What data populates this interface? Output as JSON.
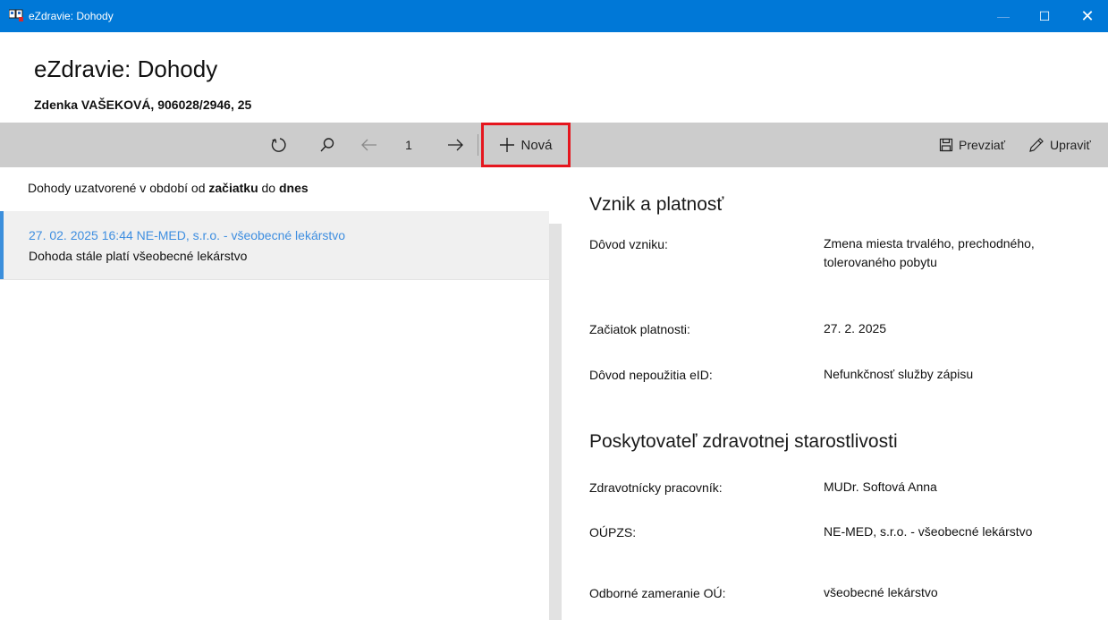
{
  "window": {
    "title": "eZdravie: Dohody",
    "minimize": "—",
    "maximize": "☐",
    "close": "✕"
  },
  "header": {
    "title": "eZdravie: Dohody",
    "patient": "Zdenka VAŠEKOVÁ, 906028/2946, 25"
  },
  "toolbar": {
    "page": "1",
    "new_label": "Nová",
    "download_label": "Prevziať",
    "edit_label": "Upraviť"
  },
  "list": {
    "range": {
      "prefix": "Dohody uzatvorené v období od ",
      "from": "začiatku",
      "middle": " do ",
      "to": "dnes"
    },
    "items": [
      {
        "line1": "27. 02. 2025 16:44   NE-MED, s.r.o. - všeobecné lekárstvo",
        "line2": "Dohoda stále platí   všeobecné lekárstvo"
      }
    ]
  },
  "detail": {
    "section1": {
      "title": "Vznik a platnosť",
      "rows": [
        {
          "label": "Dôvod vzniku:",
          "value": "Zmena miesta trvalého, prechodného, tolerovaného pobytu"
        },
        {
          "label": "Začiatok platnosti:",
          "value": "27. 2. 2025"
        },
        {
          "label": "Dôvod nepoužitia eID:",
          "value": "Nefunkčnosť služby zápisu"
        }
      ]
    },
    "section2": {
      "title": "Poskytovateľ zdravotnej starostlivosti",
      "rows": [
        {
          "label": "Zdravotnícky pracovník:",
          "value": "MUDr. Softová Anna"
        },
        {
          "label": "OÚPZS:",
          "value": "NE-MED, s.r.o. - všeobecné lekárstvo"
        },
        {
          "label": "Odborné zameranie OÚ:",
          "value": "všeobecné lekárstvo"
        }
      ]
    }
  },
  "colors": {
    "titlebar": "#0078d7",
    "toolbar": "#cccccc",
    "accent": "#3e8ee0",
    "highlight_frame": "#e5161e"
  },
  "icons": [
    "app-icon",
    "refresh-icon",
    "search-icon",
    "arrow-left-icon",
    "arrow-right-icon",
    "plus-icon",
    "save-icon",
    "pencil-icon"
  ]
}
